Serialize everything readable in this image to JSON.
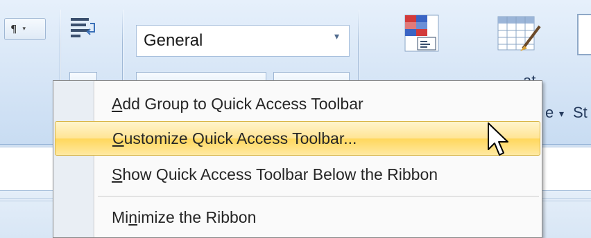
{
  "ribbon": {
    "paragraph_button_glyph": "¶",
    "dropdown_arrow_glyph": "▾",
    "number_format_value": "General",
    "partial_labels": {
      "format_fragment_top": "at",
      "format_fragment_bottom": "e",
      "styles_fragment": "St"
    }
  },
  "context_menu": {
    "items": [
      {
        "label_pre": "",
        "mnemonic": "A",
        "label_post": "dd Group to Quick Access Toolbar",
        "highlighted": false
      },
      {
        "label_pre": "",
        "mnemonic": "C",
        "label_post": "ustomize Quick Access Toolbar...",
        "highlighted": true
      },
      {
        "label_pre": "",
        "mnemonic": "S",
        "label_post": "how Quick Access Toolbar Below the Ribbon",
        "highlighted": false
      },
      {
        "label_pre": "Mi",
        "mnemonic": "n",
        "label_post": "imize the Ribbon",
        "highlighted": false
      }
    ]
  },
  "colors": {
    "ribbon_bg": "#d6e5f6",
    "menu_highlight": "#ffe494",
    "menu_highlight_border": "#d8b445",
    "menu_gutter": "#e9eef4"
  },
  "icons": [
    "paragraph-mark-icon",
    "wrap-text-icon",
    "conditional-formatting-icon",
    "format-as-table-icon",
    "cell-styles-icon",
    "mouse-pointer-icon"
  ]
}
